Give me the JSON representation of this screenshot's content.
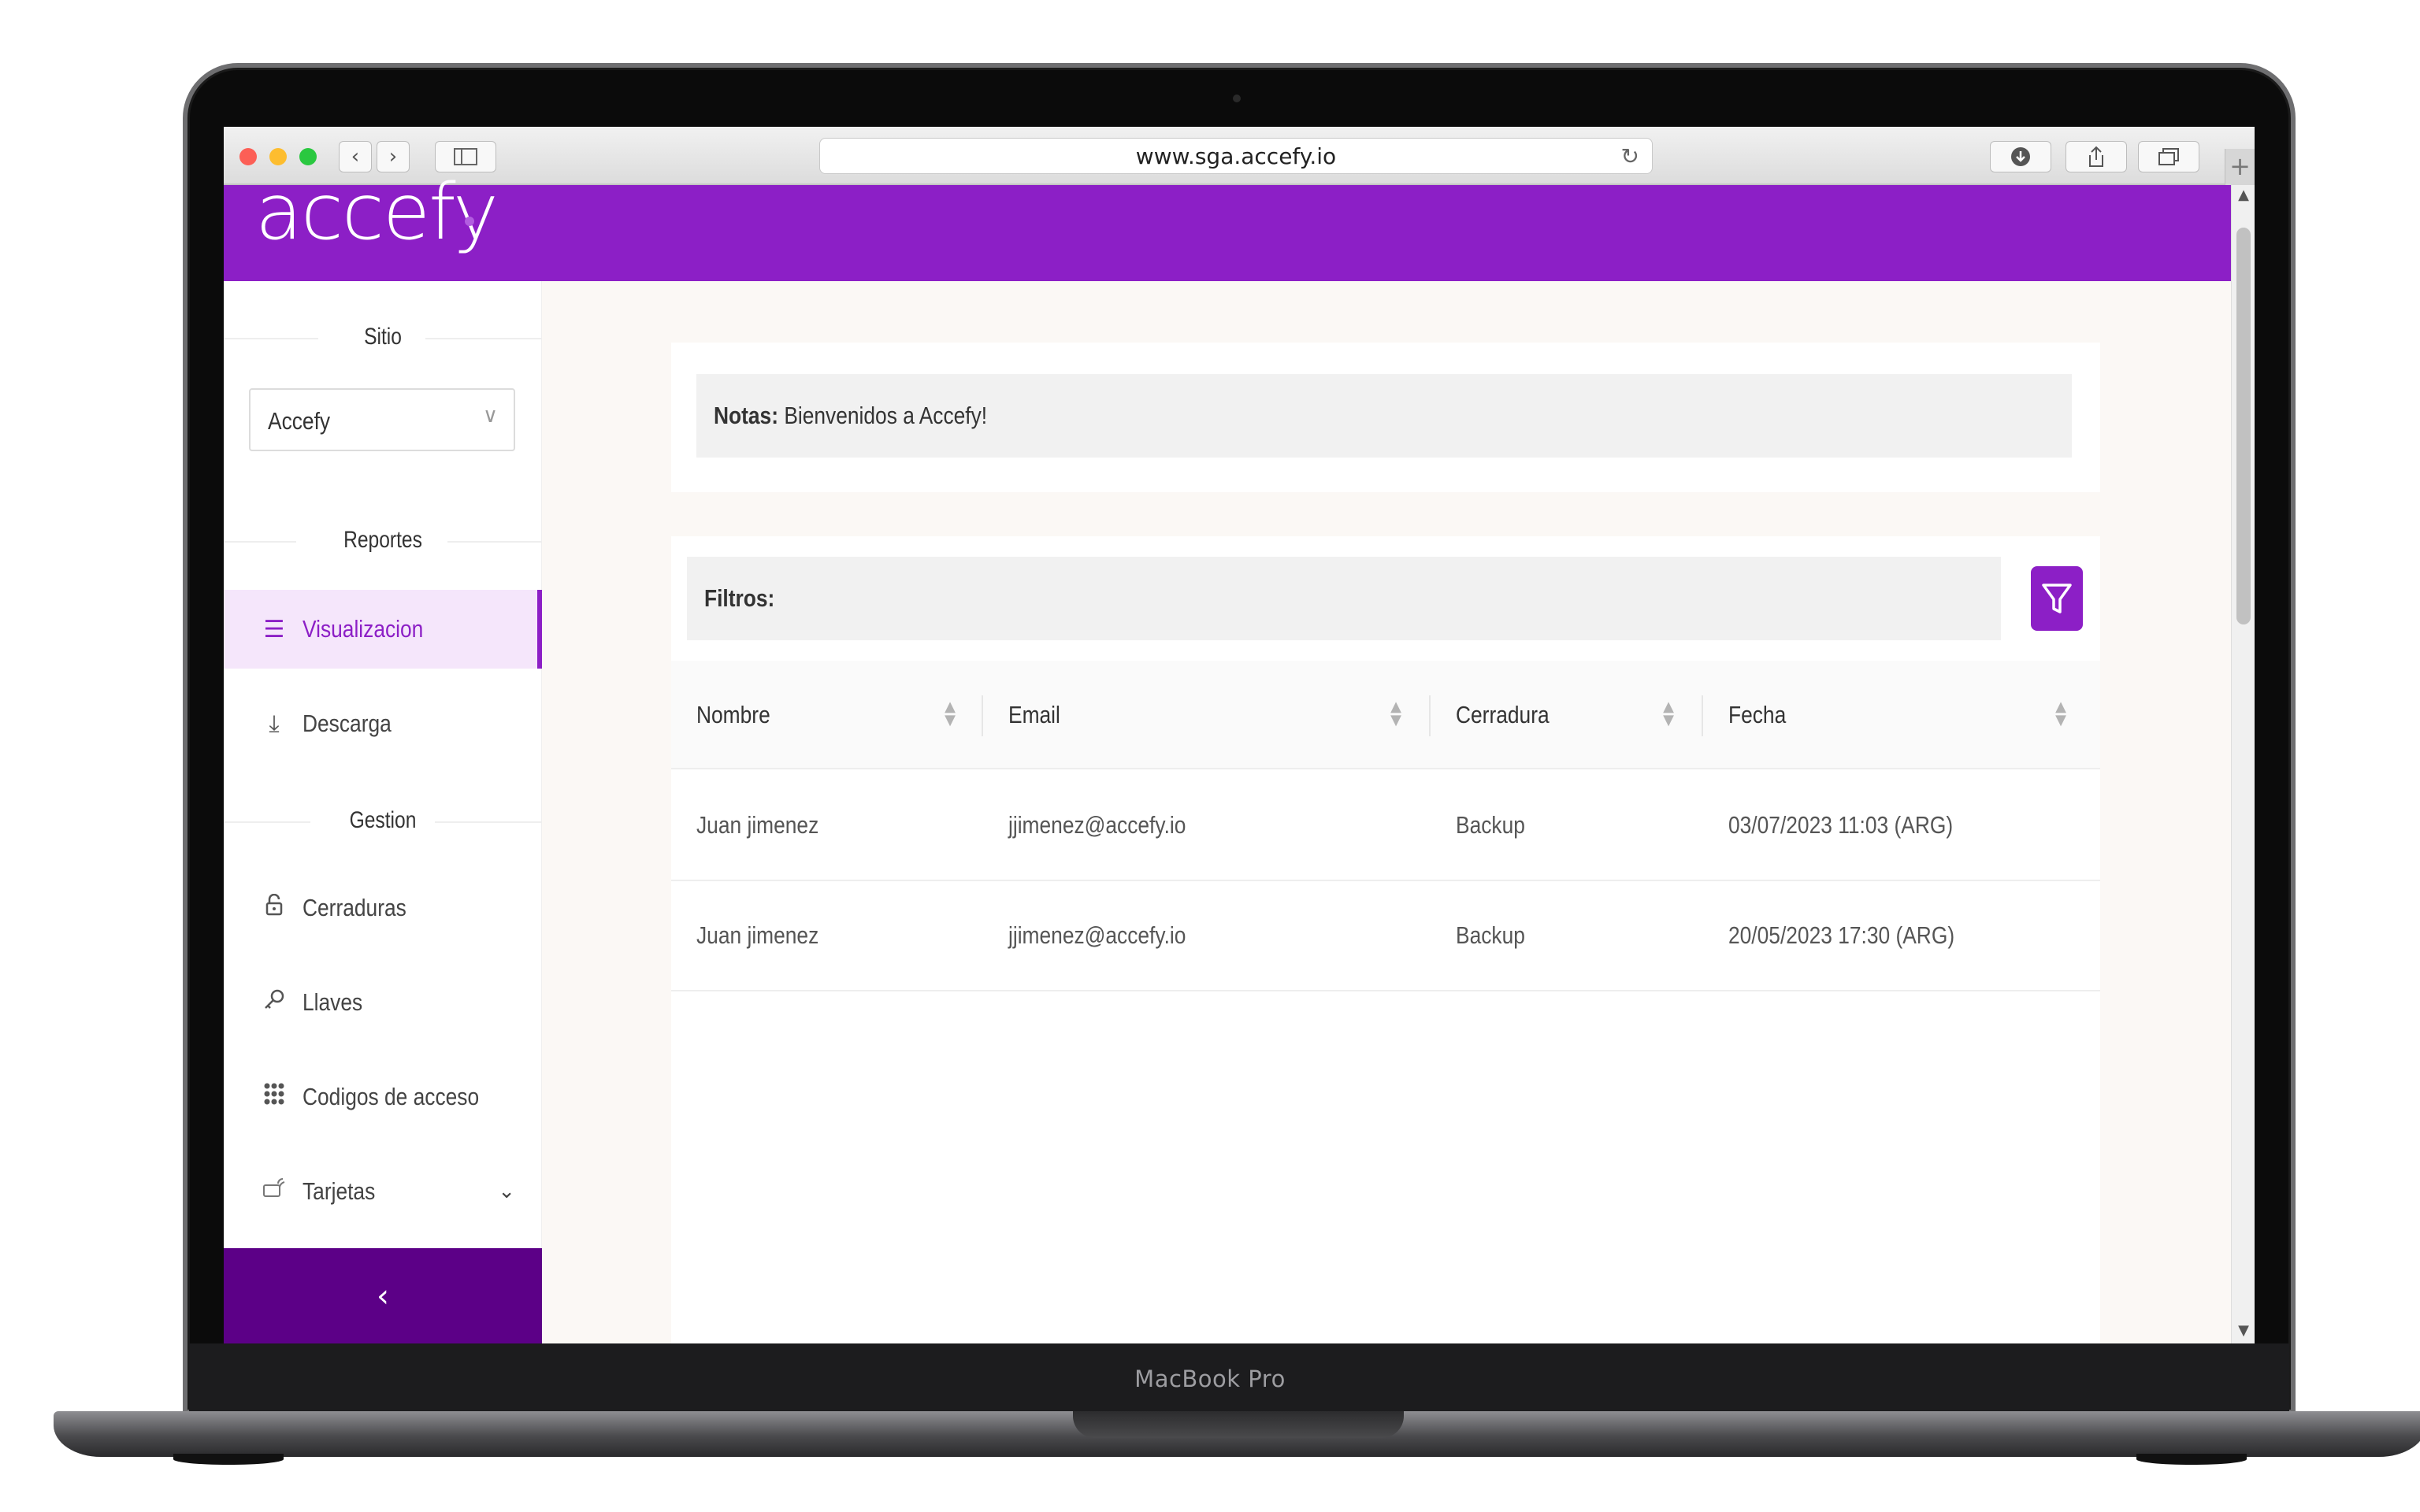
{
  "device": {
    "label": "MacBook Pro"
  },
  "browser": {
    "url": "www.sga.accefy.io"
  },
  "app": {
    "logo_text": "accefy",
    "brand_color": "#8c1fc6",
    "accent_dark": "#5c0087"
  },
  "sidebar": {
    "site_section_title": "Sitio",
    "site_select_value": "Accefy",
    "reports_section_title": "Reportes",
    "reports_items": [
      {
        "label": "Visualizacion",
        "icon": "list-icon",
        "active": true
      },
      {
        "label": "Descarga",
        "icon": "download-icon",
        "active": false
      }
    ],
    "management_section_title": "Gestion",
    "management_items": [
      {
        "label": "Cerraduras",
        "icon": "lock-icon"
      },
      {
        "label": "Llaves",
        "icon": "key-icon"
      },
      {
        "label": "Codigos de acceso",
        "icon": "keypad-icon"
      },
      {
        "label": "Tarjetas",
        "icon": "card-icon"
      }
    ]
  },
  "notes": {
    "label": "Notas:",
    "text": "Bienvenidos a Accefy!"
  },
  "filters": {
    "label": "Filtros:"
  },
  "table": {
    "columns": [
      "Nombre",
      "Email",
      "Cerradura",
      "Fecha"
    ],
    "rows": [
      [
        "Juan jimenez",
        "jjimenez@accefy.io",
        "Backup",
        "03/07/2023 11:03 (ARG)"
      ],
      [
        "Juan jimenez",
        "jjimenez@accefy.io",
        "Backup",
        "20/05/2023 17:30 (ARG)"
      ]
    ]
  }
}
